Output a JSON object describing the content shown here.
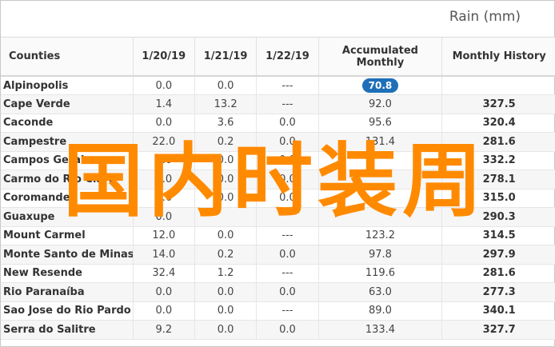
{
  "title": "Rain (mm)",
  "columns": [
    "Counties",
    "1/20/19",
    "1/21/19",
    "1/22/19",
    "Accumulated Monthly",
    "Monthly History"
  ],
  "rows": [
    {
      "county": "Alpinopolis",
      "d1": "0.0",
      "d2": "0.0",
      "d3": "---",
      "acc": "70.8",
      "hist": "",
      "highlight": true
    },
    {
      "county": "Cape Verde",
      "d1": "1.4",
      "d2": "13.2",
      "d3": "---",
      "acc": "92.0",
      "hist": "327.5"
    },
    {
      "county": "Caconde",
      "d1": "0.0",
      "d2": "3.6",
      "d3": "0.0",
      "acc": "95.6",
      "hist": "320.4"
    },
    {
      "county": "Campestre",
      "d1": "22.0",
      "d2": "0.2",
      "d3": "0.0",
      "acc": "131.4",
      "hist": "281.6"
    },
    {
      "county": "Campos Gerais",
      "d1": "0.0",
      "d2": "0.0",
      "d3": "0.0",
      "acc": "",
      "hist": "332.2"
    },
    {
      "county": "Carmo do Rio Claro",
      "d1": "0.0",
      "d2": "0.0",
      "d3": "0.0",
      "acc": "",
      "hist": "278.1"
    },
    {
      "county": "Coromandel",
      "d1": "0.0",
      "d2": "0.0",
      "d3": "0.0",
      "acc": "",
      "hist": "315.0"
    },
    {
      "county": "Guaxupe",
      "d1": "0.0",
      "d2": "",
      "d3": "",
      "acc": "",
      "hist": "290.3"
    },
    {
      "county": "Mount Carmel",
      "d1": "12.0",
      "d2": "0.0",
      "d3": "---",
      "acc": "123.2",
      "hist": "314.5"
    },
    {
      "county": "Monte Santo de Minas",
      "d1": "14.0",
      "d2": "0.2",
      "d3": "0.0",
      "acc": "97.8",
      "hist": "297.9"
    },
    {
      "county": "New Resende",
      "d1": "32.4",
      "d2": "1.2",
      "d3": "---",
      "acc": "119.6",
      "hist": "281.6"
    },
    {
      "county": "Rio Paranaíba",
      "d1": "0.0",
      "d2": "0.0",
      "d3": "0.0",
      "acc": "63.0",
      "hist": "277.3"
    },
    {
      "county": "Sao Jose do Rio Pardo",
      "d1": "0.0",
      "d2": "0.0",
      "d3": "---",
      "acc": "89.0",
      "hist": "340.1"
    },
    {
      "county": "Serra do Salitre",
      "d1": "9.2",
      "d2": "0.0",
      "d3": "0.0",
      "acc": "133.4",
      "hist": "327.7"
    }
  ],
  "watermark": "国内时装周",
  "colors": {
    "badge": "#1e6fb8",
    "watermark": "#ff8a00"
  }
}
